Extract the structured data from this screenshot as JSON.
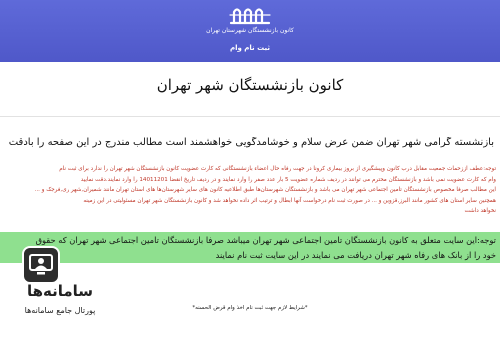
{
  "header": {
    "org_name": "کانون بازنشستگان شهرستان تهران",
    "subtitle": "ثبت نام وام"
  },
  "main": {
    "heading": "کانون بازنشستگان شهر تهران",
    "greeting": "بازنشسته گرامی شهر تهران  ضمن عرض سلام و خوشامدگویی خواهشمند است مطالب مندرج در این صفحه را بادقت مطالعه نمایید",
    "red_notice_lines": [
      "توجه:عطف اززحمات جمعیت مقابل درب کانون وپیشگیری از بروز بیماری کرونا در جهت رفاه حال اعضاء بازنشستگانی که کارت عضویت کانون بازنشستگان شهر تهران را ندارد برای ثبت نام",
      "وام که کارت عضویت نمی باشد و بازنشستگان محترم می توانند در ردیف شماره عضویت 5 بار عدد صفر را وارد نمایند و در ردیف تاریخ انقضا 14011201 را وارد نمایند.دقت نمایید",
      "این مطالب صرفا مخصوص بازنشستگان تامین اجتماعی شهر تهران می باشد و بازنشستگان شهرستان‌ها طبق اطلاعیه کانون های سایر شهرستان‌ها  های استان تهران مانند شمیران,شهر ری,فرجک و ...",
      "همچنین سایر استان های کشور مانند البرز,قزوین و ... در صورت ثبت نام درخواست آنها ابطال  و ترتیب اثر داده نخواهد شد و کانون بازنشستگان شهر تهران مسئولیتی در این زمینه",
      "نخواهد داشت"
    ],
    "green_notice_lines": [
      "توجه:این سایت متعلق به کانون بازنشستگان تامین اجتماعی شهر تهران میباشد صرفا بازنشستگان تامین اجتماعی شهر تهران که حقوق",
      "خود را از بانک های رفاه شهر تهران دریافت می نمایند  در این سایت ثبت نام نمایند"
    ],
    "condition_note": "*شرایط لازم جهت ثبت نام اخذ وام قرض الحسنه*"
  },
  "watermark": {
    "brand": "سامانه‌ها",
    "tagline": "پورتال جامع سامانه‌ها"
  },
  "colors": {
    "header_bg": "#5b64d4",
    "green_highlight": "#8fe08f",
    "notice_red": "#c0392b"
  }
}
